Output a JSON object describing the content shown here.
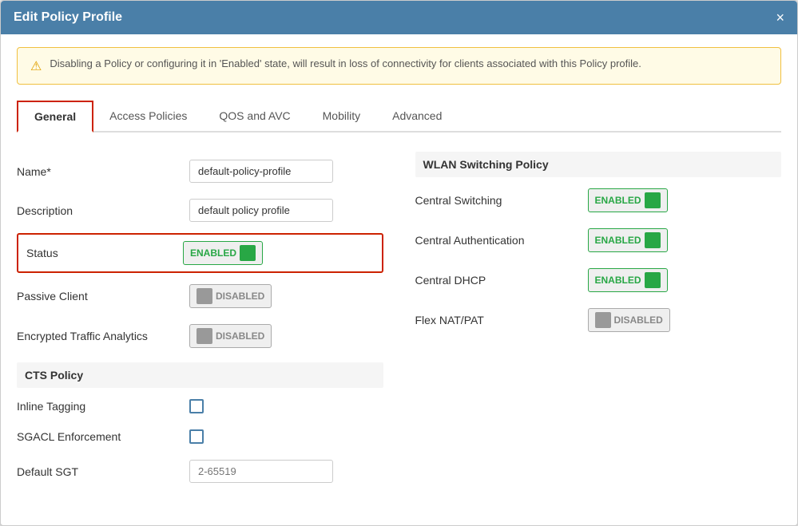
{
  "modal": {
    "title": "Edit Policy Profile",
    "close_label": "×"
  },
  "warning": {
    "icon": "⚠",
    "text": "Disabling a Policy or configuring it in 'Enabled' state, will result in loss of connectivity for clients associated with this Policy profile."
  },
  "tabs": [
    {
      "id": "general",
      "label": "General",
      "active": true
    },
    {
      "id": "access-policies",
      "label": "Access Policies",
      "active": false
    },
    {
      "id": "qos-avc",
      "label": "QOS and AVC",
      "active": false
    },
    {
      "id": "mobility",
      "label": "Mobility",
      "active": false
    },
    {
      "id": "advanced",
      "label": "Advanced",
      "active": false
    }
  ],
  "form": {
    "name_label": "Name*",
    "name_value": "default-policy-profile",
    "description_label": "Description",
    "description_value": "default policy profile",
    "status_label": "Status",
    "status_value": "ENABLED",
    "passive_client_label": "Passive Client",
    "passive_client_value": "DISABLED",
    "encrypted_traffic_label": "Encrypted Traffic Analytics",
    "encrypted_traffic_value": "DISABLED",
    "cts_policy_label": "CTS Policy",
    "inline_tagging_label": "Inline Tagging",
    "sgacl_enforcement_label": "SGACL Enforcement",
    "default_sgt_label": "Default SGT",
    "default_sgt_placeholder": "2-65519"
  },
  "wlan": {
    "section_title": "WLAN Switching Policy",
    "central_switching_label": "Central Switching",
    "central_switching_value": "ENABLED",
    "central_auth_label": "Central Authentication",
    "central_auth_value": "ENABLED",
    "central_dhcp_label": "Central DHCP",
    "central_dhcp_value": "ENABLED",
    "flex_nat_label": "Flex NAT/PAT",
    "flex_nat_value": "DISABLED"
  }
}
